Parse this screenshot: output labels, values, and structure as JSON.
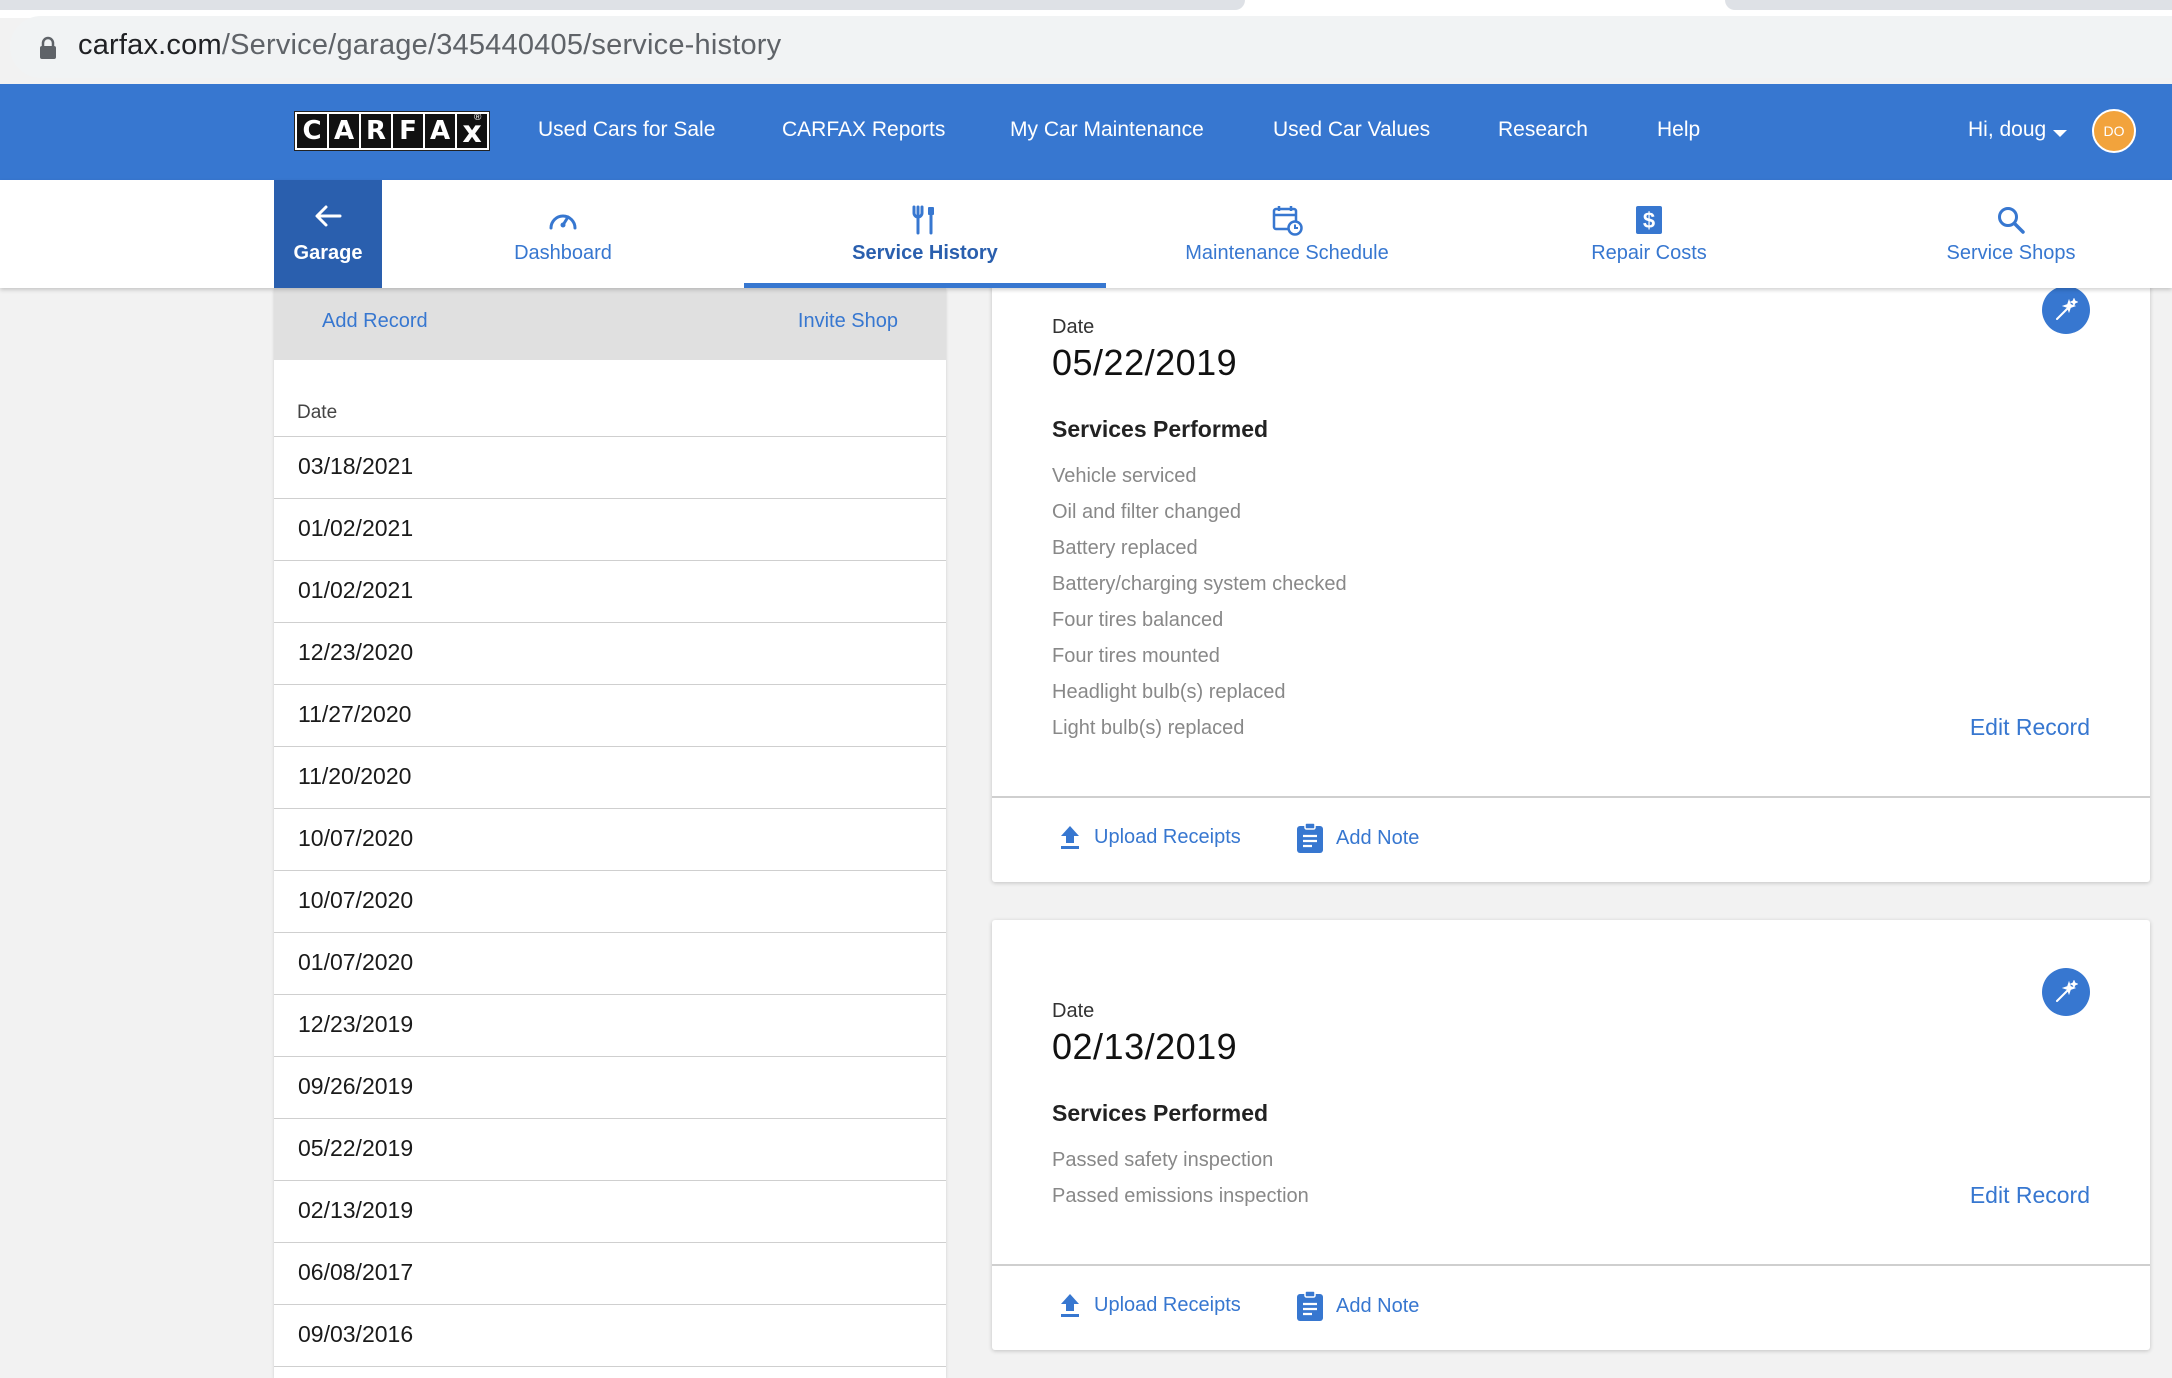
{
  "browser": {
    "url_host": "carfax.com",
    "url_path": "/Service/garage/345440405/service-history"
  },
  "topnav": {
    "logo_letters": [
      "C",
      "A",
      "R",
      "F",
      "A",
      "x"
    ],
    "links": [
      "Used Cars for Sale",
      "CARFAX Reports",
      "My Car Maintenance",
      "Used Car Values",
      "Research",
      "Help"
    ],
    "user_greeting": "Hi, doug",
    "avatar_initials": "DO"
  },
  "subnav": {
    "garage_label": "Garage",
    "items": [
      {
        "label": "Dashboard",
        "icon": "speedometer-icon"
      },
      {
        "label": "Service History",
        "icon": "tools-icon",
        "active": true
      },
      {
        "label": "Maintenance Schedule",
        "icon": "calendar-clock-icon"
      },
      {
        "label": "Repair Costs",
        "icon": "dollar-icon"
      },
      {
        "label": "Service Shops",
        "icon": "search-icon"
      }
    ]
  },
  "left_panel": {
    "add_record": "Add Record",
    "invite_shop": "Invite Shop",
    "date_header": "Date",
    "dates": [
      "03/18/2021",
      "01/02/2021",
      "01/02/2021",
      "12/23/2020",
      "11/27/2020",
      "11/20/2020",
      "10/07/2020",
      "10/07/2020",
      "01/07/2020",
      "12/23/2019",
      "09/26/2019",
      "05/22/2019",
      "02/13/2019",
      "06/08/2017",
      "09/03/2016"
    ]
  },
  "records": [
    {
      "date_label": "Date",
      "date": "05/22/2019",
      "services_title": "Services Performed",
      "services": [
        "Vehicle serviced",
        "Oil and filter changed",
        "Battery replaced",
        "Battery/charging system checked",
        "Four tires balanced",
        "Four tires mounted",
        "Headlight bulb(s) replaced",
        "Light bulb(s) replaced"
      ],
      "edit_label": "Edit Record",
      "upload_label": "Upload Receipts",
      "note_label": "Add Note"
    },
    {
      "date_label": "Date",
      "date": "02/13/2019",
      "services_title": "Services Performed",
      "services": [
        "Passed safety inspection",
        "Passed emissions inspection"
      ],
      "edit_label": "Edit Record",
      "upload_label": "Upload Receipts",
      "note_label": "Add Note"
    }
  ],
  "colors": {
    "brand_blue": "#3777d0",
    "dark_blue": "#2a5fae",
    "avatar_orange": "#f2a33c"
  }
}
